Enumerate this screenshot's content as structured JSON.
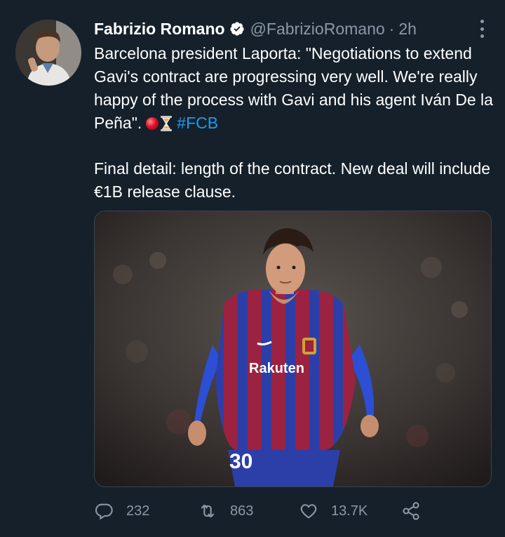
{
  "tweet": {
    "author_name": "Fabrizio Romano",
    "author_handle": "@FabrizioRomano",
    "separator": "·",
    "time": "2h",
    "text_paragraph_1_main": "Barcelona president Laporta: \"Negotiations to extend Gavi's contract are progressing very well. We're really happy of the process with Gavi and his agent Iván De la Peña\".",
    "hashtag": "#FCB",
    "text_paragraph_2": "Final detail: length of the contract. New deal will include €1B release clause.",
    "jersey_sponsor": "Rakuten",
    "jersey_number": "30"
  },
  "actions": {
    "replies": "232",
    "retweets": "863",
    "likes": "13.7K"
  },
  "colors": {
    "background": "#15202b",
    "muted": "#8b98a5",
    "link": "#1d9bf0",
    "verified_badge": "#ffffff"
  },
  "icons": [
    "verified-badge-icon",
    "more-options-icon",
    "reply-icon",
    "retweet-icon",
    "like-icon",
    "share-icon"
  ]
}
